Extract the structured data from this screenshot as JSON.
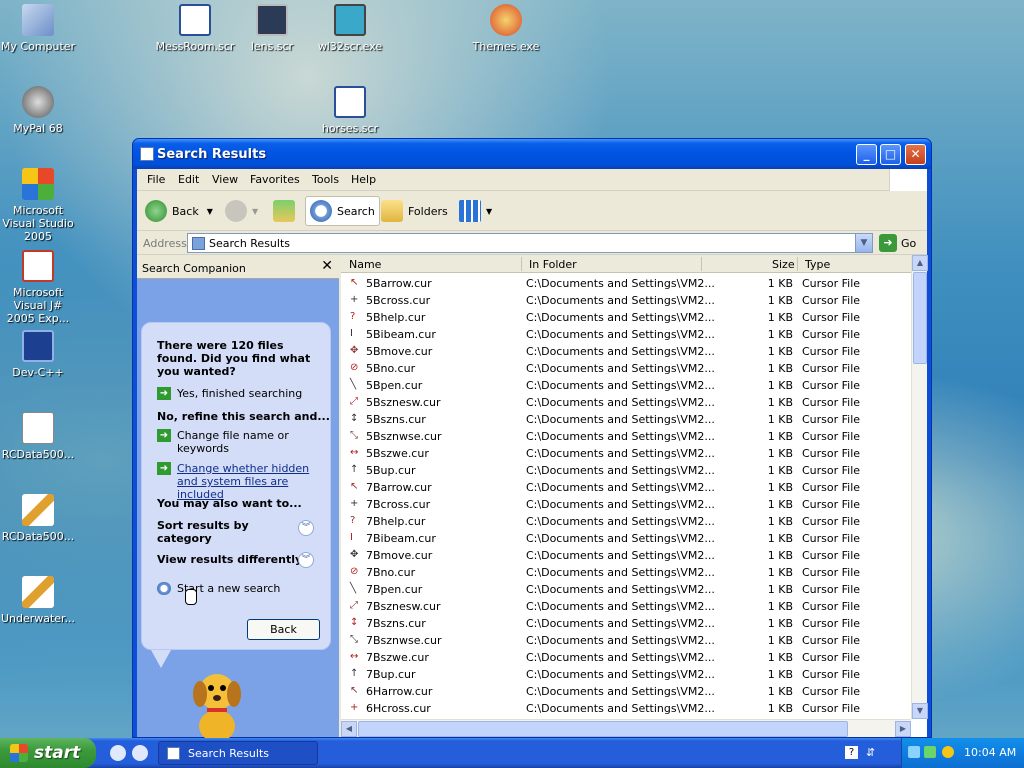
{
  "desktop": {
    "icons": [
      {
        "label": "My Computer"
      },
      {
        "label": "MessRoom.scr"
      },
      {
        "label": "lens.scr"
      },
      {
        "label": "wl32scr.exe"
      },
      {
        "label": "Themes.exe"
      },
      {
        "label": "MyPal 68"
      },
      {
        "label": "horses.scr"
      },
      {
        "label": "Microsoft Visual Studio 2005"
      },
      {
        "label": "Microsoft Visual J# 2005 Exp..."
      },
      {
        "label": "Dev-C++"
      },
      {
        "label": "RCData500..."
      },
      {
        "label": "RCData500..."
      },
      {
        "label": "Underwater..."
      }
    ]
  },
  "window": {
    "title": "Search Results",
    "menu": [
      "File",
      "Edit",
      "View",
      "Favorites",
      "Tools",
      "Help"
    ],
    "toolbar": {
      "back": "Back",
      "search": "Search",
      "folders": "Folders"
    },
    "address": {
      "label": "Address",
      "value": "Search Results",
      "go": "Go"
    }
  },
  "companion": {
    "header": "Search Companion",
    "found_text": "There were 120 files found. Did you find what you wanted?",
    "yes_link": "Yes, finished searching",
    "refine_heading": "No, refine this search and...",
    "refine_link_1": "Change file name or keywords",
    "refine_link_2": "Change whether hidden and system files are included",
    "also_heading": "You may also want to...",
    "sort_link": "Sort results by category",
    "view_link": "View results differently",
    "new_search": "Start a new search",
    "back_button": "Back"
  },
  "results": {
    "columns": {
      "name": "Name",
      "folder": "In Folder",
      "size": "Size",
      "type": "Type"
    },
    "rows": [
      {
        "name": "5Barrow.cur",
        "folder": "C:\\Documents and Settings\\VM2...",
        "size": "1 KB",
        "type": "Cursor File",
        "icon": "↖"
      },
      {
        "name": "5Bcross.cur",
        "folder": "C:\\Documents and Settings\\VM2...",
        "size": "1 KB",
        "type": "Cursor File",
        "icon": "+"
      },
      {
        "name": "5Bhelp.cur",
        "folder": "C:\\Documents and Settings\\VM2...",
        "size": "1 KB",
        "type": "Cursor File",
        "icon": "?"
      },
      {
        "name": "5Bibeam.cur",
        "folder": "C:\\Documents and Settings\\VM2...",
        "size": "1 KB",
        "type": "Cursor File",
        "icon": "I"
      },
      {
        "name": "5Bmove.cur",
        "folder": "C:\\Documents and Settings\\VM2...",
        "size": "1 KB",
        "type": "Cursor File",
        "icon": "✥"
      },
      {
        "name": "5Bno.cur",
        "folder": "C:\\Documents and Settings\\VM2...",
        "size": "1 KB",
        "type": "Cursor File",
        "icon": "⊘"
      },
      {
        "name": "5Bpen.cur",
        "folder": "C:\\Documents and Settings\\VM2...",
        "size": "1 KB",
        "type": "Cursor File",
        "icon": "╲"
      },
      {
        "name": "5Bsznesw.cur",
        "folder": "C:\\Documents and Settings\\VM2...",
        "size": "1 KB",
        "type": "Cursor File",
        "icon": "⤢"
      },
      {
        "name": "5Bszns.cur",
        "folder": "C:\\Documents and Settings\\VM2...",
        "size": "1 KB",
        "type": "Cursor File",
        "icon": "↕"
      },
      {
        "name": "5Bsznwse.cur",
        "folder": "C:\\Documents and Settings\\VM2...",
        "size": "1 KB",
        "type": "Cursor File",
        "icon": "⤡"
      },
      {
        "name": "5Bszwe.cur",
        "folder": "C:\\Documents and Settings\\VM2...",
        "size": "1 KB",
        "type": "Cursor File",
        "icon": "↔"
      },
      {
        "name": "5Bup.cur",
        "folder": "C:\\Documents and Settings\\VM2...",
        "size": "1 KB",
        "type": "Cursor File",
        "icon": "↑"
      },
      {
        "name": "7Barrow.cur",
        "folder": "C:\\Documents and Settings\\VM2...",
        "size": "1 KB",
        "type": "Cursor File",
        "icon": "↖"
      },
      {
        "name": "7Bcross.cur",
        "folder": "C:\\Documents and Settings\\VM2...",
        "size": "1 KB",
        "type": "Cursor File",
        "icon": "+"
      },
      {
        "name": "7Bhelp.cur",
        "folder": "C:\\Documents and Settings\\VM2...",
        "size": "1 KB",
        "type": "Cursor File",
        "icon": "?"
      },
      {
        "name": "7Bibeam.cur",
        "folder": "C:\\Documents and Settings\\VM2...",
        "size": "1 KB",
        "type": "Cursor File",
        "icon": "I"
      },
      {
        "name": "7Bmove.cur",
        "folder": "C:\\Documents and Settings\\VM2...",
        "size": "1 KB",
        "type": "Cursor File",
        "icon": "✥"
      },
      {
        "name": "7Bno.cur",
        "folder": "C:\\Documents and Settings\\VM2...",
        "size": "1 KB",
        "type": "Cursor File",
        "icon": "⊘"
      },
      {
        "name": "7Bpen.cur",
        "folder": "C:\\Documents and Settings\\VM2...",
        "size": "1 KB",
        "type": "Cursor File",
        "icon": "╲"
      },
      {
        "name": "7Bsznesw.cur",
        "folder": "C:\\Documents and Settings\\VM2...",
        "size": "1 KB",
        "type": "Cursor File",
        "icon": "⤢"
      },
      {
        "name": "7Bszns.cur",
        "folder": "C:\\Documents and Settings\\VM2...",
        "size": "1 KB",
        "type": "Cursor File",
        "icon": "↕"
      },
      {
        "name": "7Bsznwse.cur",
        "folder": "C:\\Documents and Settings\\VM2...",
        "size": "1 KB",
        "type": "Cursor File",
        "icon": "⤡"
      },
      {
        "name": "7Bszwe.cur",
        "folder": "C:\\Documents and Settings\\VM2...",
        "size": "1 KB",
        "type": "Cursor File",
        "icon": "↔"
      },
      {
        "name": "7Bup.cur",
        "folder": "C:\\Documents and Settings\\VM2...",
        "size": "1 KB",
        "type": "Cursor File",
        "icon": "↑"
      },
      {
        "name": "6Harrow.cur",
        "folder": "C:\\Documents and Settings\\VM2...",
        "size": "1 KB",
        "type": "Cursor File",
        "icon": "↖"
      },
      {
        "name": "6Hcross.cur",
        "folder": "C:\\Documents and Settings\\VM2...",
        "size": "1 KB",
        "type": "Cursor File",
        "icon": "+"
      }
    ]
  },
  "taskbar": {
    "start": "start",
    "task": "Search Results",
    "clock": "10:04 AM"
  }
}
